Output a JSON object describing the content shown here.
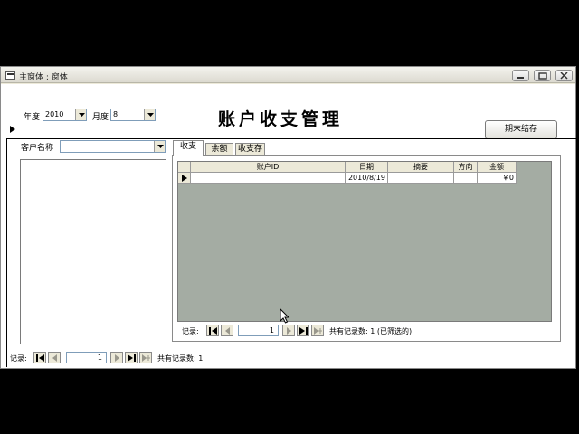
{
  "window": {
    "title": "主窗体 : 窗体"
  },
  "header": {
    "title": "账户收支管理",
    "year_label": "年度",
    "year_value": "2010",
    "month_label": "月度",
    "month_value": "8",
    "close_period_button": "期末结存"
  },
  "customer": {
    "label": "客户名称",
    "value": ""
  },
  "tabs": [
    {
      "label": "收支",
      "active": true
    },
    {
      "label": "余额",
      "active": false
    },
    {
      "label": "收支存",
      "active": false
    }
  ],
  "grid": {
    "columns": [
      "账户ID",
      "日期",
      "摘要",
      "方向",
      "金额"
    ],
    "rows": [
      {
        "account_id": "",
        "date": "2010/8/19",
        "summary": "",
        "direction": "",
        "amount": "￥0"
      }
    ]
  },
  "subform_nav": {
    "label": "记录:",
    "current": "1",
    "status": "共有记录数: 1  (已筛选的)"
  },
  "form_nav": {
    "label": "记录:",
    "current": "1",
    "status": "共有记录数: 1"
  }
}
